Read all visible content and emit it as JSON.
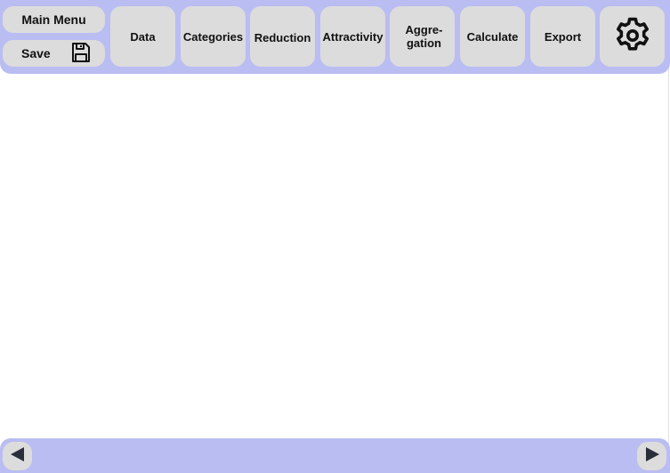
{
  "toolbar": {
    "main_menu_label": "Main Menu",
    "save_label": "Save",
    "save_icon": "floppy-disk-icon",
    "tabs": [
      {
        "label": "Data"
      },
      {
        "label": "Categories"
      },
      {
        "label": "Reduction"
      },
      {
        "label": "Attractivity"
      },
      {
        "label": "Aggre-\ngation"
      },
      {
        "label": "Calculate"
      },
      {
        "label": "Export"
      }
    ],
    "settings_icon": "gear-icon"
  },
  "footer": {
    "prev_icon": "triangle-left-icon",
    "next_icon": "triangle-right-icon"
  },
  "colors": {
    "bar_background": "#babdf2",
    "button_background": "#dcdcdc",
    "icon_dark": "#2a2d3a"
  }
}
